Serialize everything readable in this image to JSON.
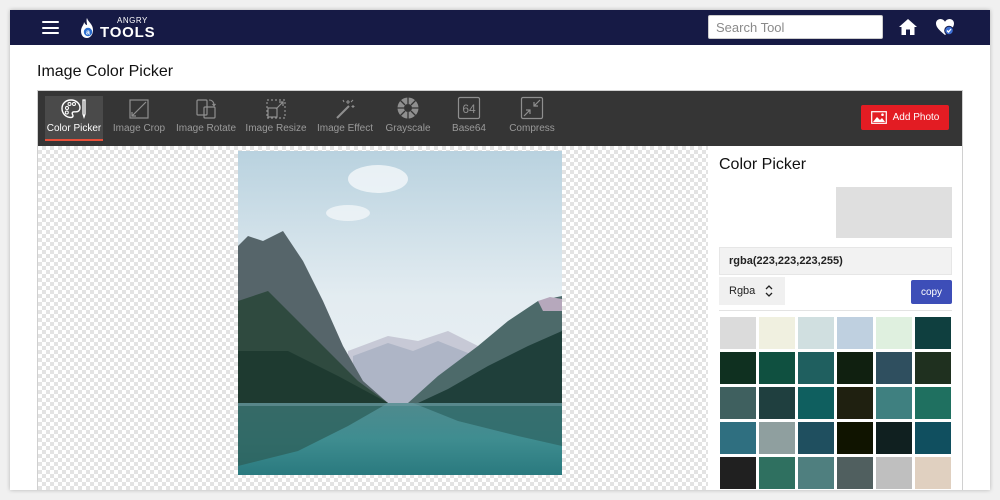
{
  "header": {
    "logo_small": "ANGRY",
    "logo_big": "TOOLS",
    "search_placeholder": "Search Tool"
  },
  "page_title": "Image Color Picker",
  "toolbar": {
    "tools": [
      {
        "label": "Color Picker",
        "icon": "palette-icon",
        "active": true
      },
      {
        "label": "Image Crop",
        "icon": "crop-icon",
        "active": false
      },
      {
        "label": "Image Rotate",
        "icon": "rotate-icon",
        "active": false
      },
      {
        "label": "Image Resize",
        "icon": "resize-icon",
        "active": false
      },
      {
        "label": "Image Effect",
        "icon": "magic-wand-icon",
        "active": false
      },
      {
        "label": "Grayscale",
        "icon": "grayscale-icon",
        "active": false
      },
      {
        "label": "Base64",
        "icon": "base64-icon",
        "active": false
      },
      {
        "label": "Compress",
        "icon": "compress-icon",
        "active": false
      }
    ],
    "add_photo_label": "Add Photo"
  },
  "picker": {
    "title": "Color Picker",
    "selected_color": "#dfdfdf",
    "rgba_value": "rgba(223,223,223,255)",
    "format": "Rgba",
    "copy_label": "copy",
    "palette": [
      "#dbdbdb",
      "#f0f0e0",
      "#d0dfe0",
      "#bfd0e0",
      "#dff0df",
      "#0f3f3f",
      "#0f3020",
      "#0f5040",
      "#1f5f5f",
      "#102010",
      "#2f4f5f",
      "#1f301f",
      "#3f605f",
      "#1f3f3f",
      "#0f5f5f",
      "#1f2010",
      "#3f8080",
      "#1f7060",
      "#2f6f80",
      "#8f9f9f",
      "#1f4f5f",
      "#101400",
      "#102020",
      "#104f5f",
      "#202020",
      "#2f7060",
      "#4f7f7f",
      "#505f5f",
      "#bfbfbf",
      "#e0d0c0"
    ]
  },
  "colors": {
    "header_bg": "#161a45",
    "toolbar_bg": "#353535",
    "accent_red": "#e31c23",
    "copy_blue": "#3d4eb8",
    "active_underline": "#e8503a"
  }
}
